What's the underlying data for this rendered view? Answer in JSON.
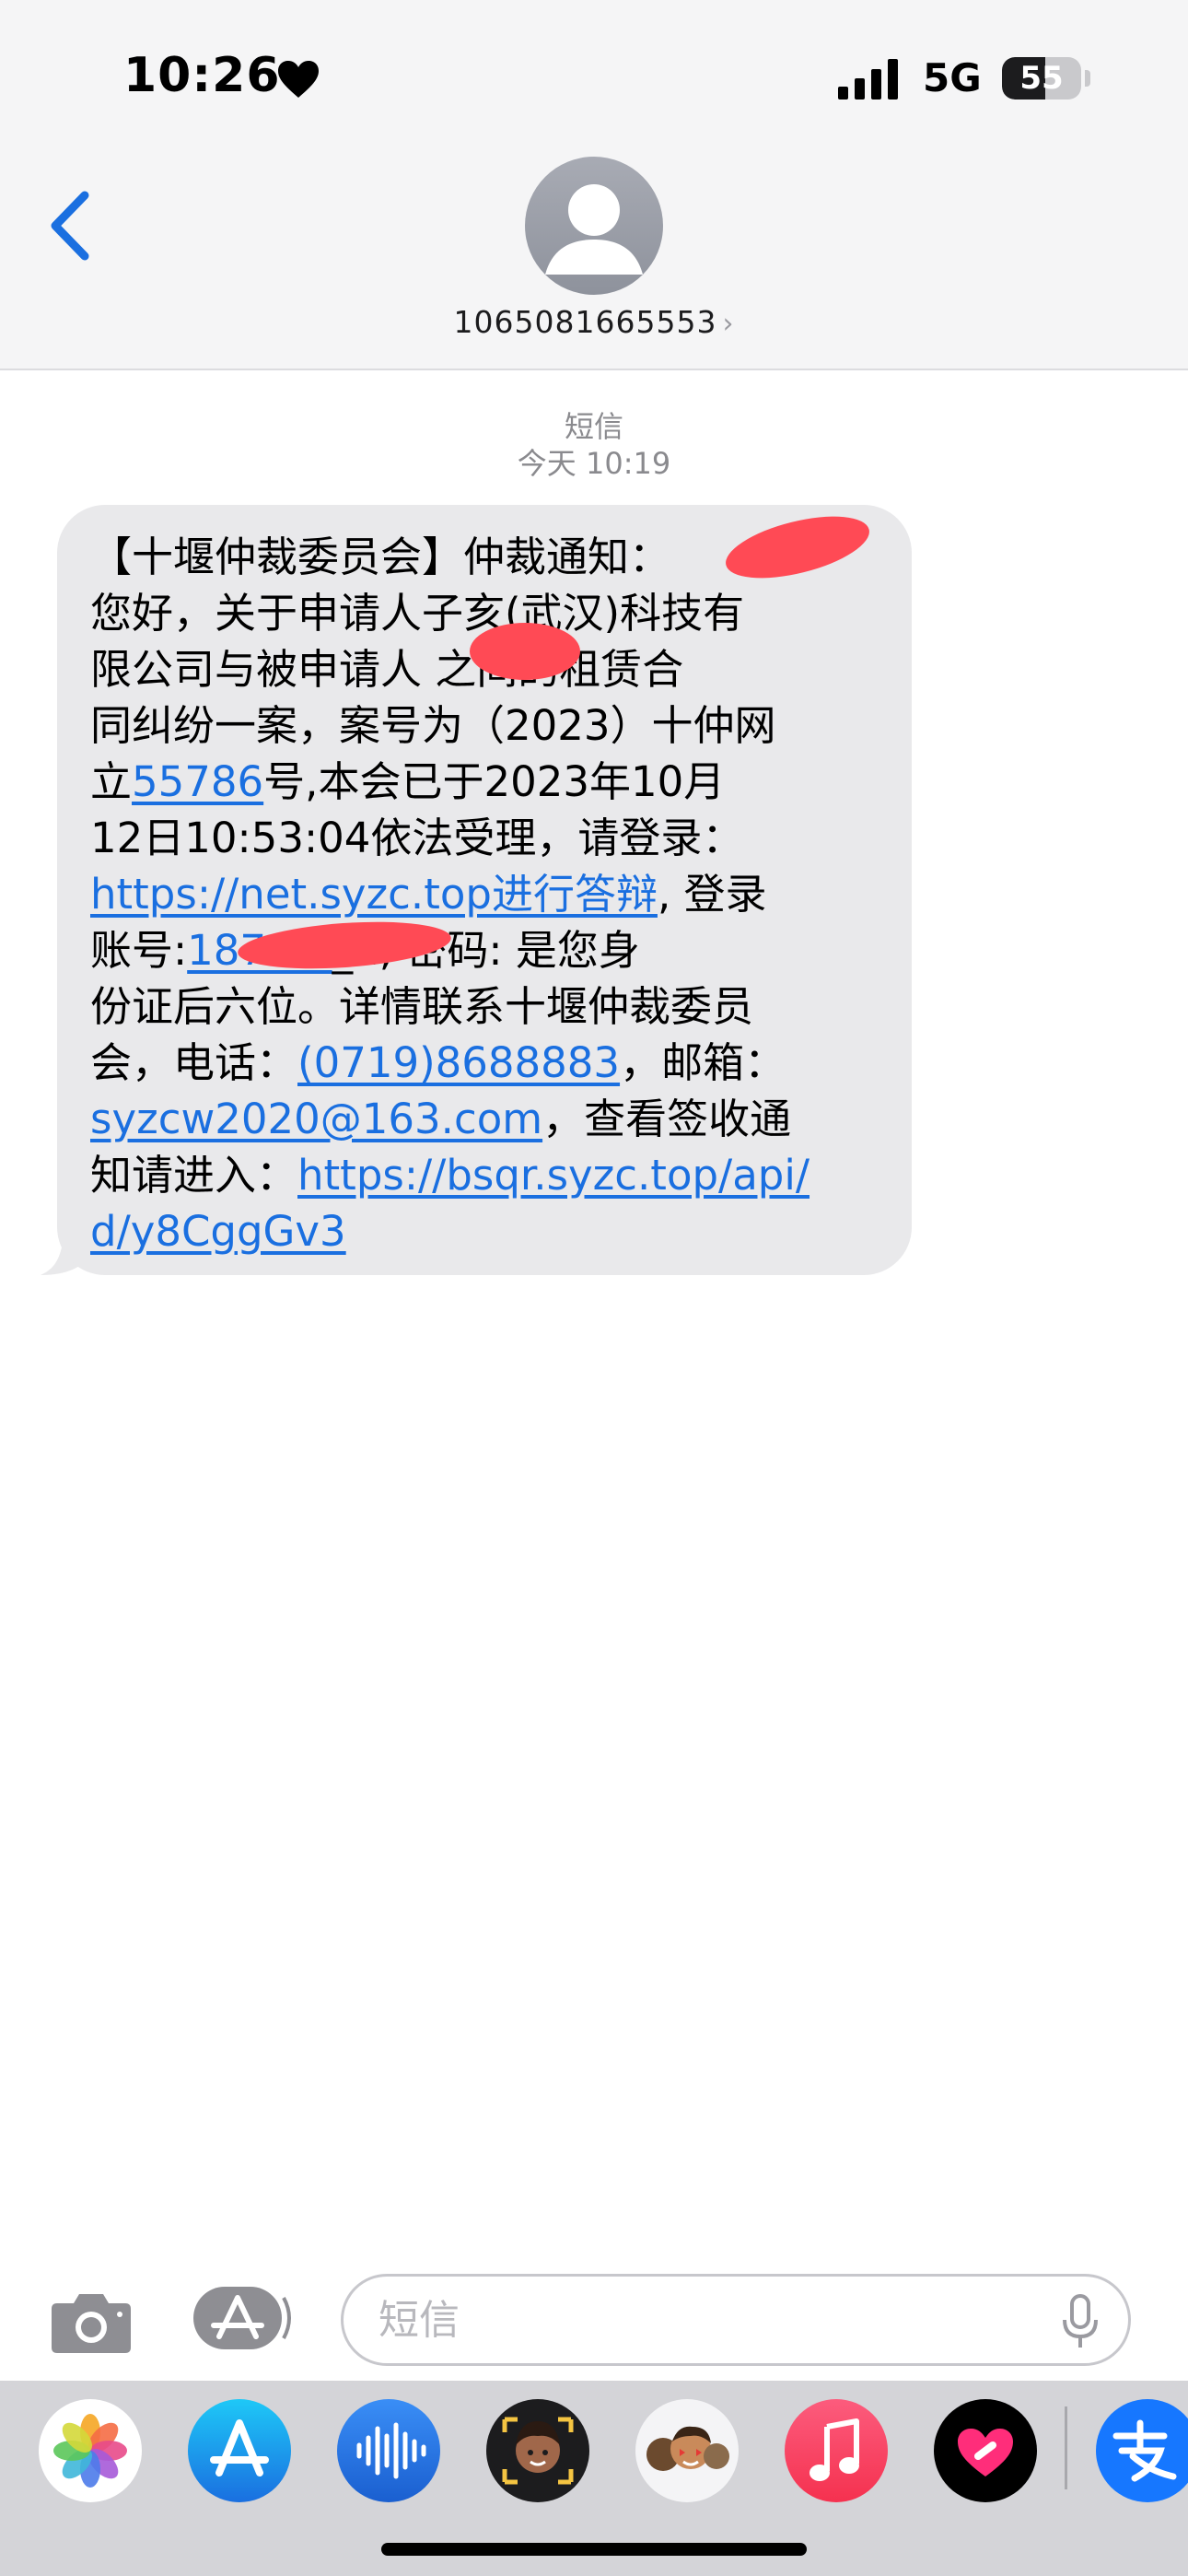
{
  "status_bar": {
    "time": "10:26",
    "network": "5G",
    "battery": "55"
  },
  "header": {
    "contact": "1065081665553",
    "chevron": "›"
  },
  "thread": {
    "type_label": "短信",
    "timestamp": "今天 10:19"
  },
  "message": {
    "lines": [
      [
        {
          "t": "【十堰仲裁委员会】仲裁通知："
        }
      ],
      [
        {
          "t": "您好，关于申请人子亥(武汉)科技有"
        }
      ],
      [
        {
          "t": "限公司与被申请人    之间的租赁合"
        }
      ],
      [
        {
          "t": "同纠纷一案，案号为（2023）十仲网"
        }
      ],
      [
        {
          "t": "立"
        },
        {
          "t": "55786",
          "link": true
        },
        {
          "t": "号,本会已于2023年10月"
        }
      ],
      [
        {
          "t": "12日10:53:04依法受理，请登录："
        }
      ],
      [
        {
          "t": "https://net.syzc.top进行答辩",
          "link": true
        },
        {
          "t": ", 登录"
        }
      ],
      [
        {
          "t": "账号:"
        },
        {
          "t": "187         91",
          "link": true
        },
        {
          "t": "_2, 密码: 是您身"
        }
      ],
      [
        {
          "t": "份证后六位。详情联系十堰仲裁委员"
        }
      ],
      [
        {
          "t": "会，电话："
        },
        {
          "t": "(0719)8688883",
          "link": true
        },
        {
          "t": "，邮箱："
        }
      ],
      [
        {
          "t": "syzcw2020@163.com",
          "link": true
        },
        {
          "t": "，查看签收通"
        }
      ],
      [
        {
          "t": "知请进入："
        },
        {
          "t": "https://bsqr.syzc.top/api/",
          "link": true
        }
      ],
      [
        {
          "t": "d/y8CggGv3",
          "link": true
        }
      ]
    ]
  },
  "input": {
    "placeholder": "短信"
  },
  "colors": {
    "accent": "#1a6fe0",
    "bubble": "#e9e9eb",
    "redaction": "#ff4a55"
  },
  "apps": [
    {
      "name": "photos-app-icon"
    },
    {
      "name": "app-store-app-icon"
    },
    {
      "name": "audio-message-app-icon"
    },
    {
      "name": "memoji-app-icon"
    },
    {
      "name": "memoji-stickers-app-icon"
    },
    {
      "name": "music-app-icon"
    },
    {
      "name": "digital-touch-app-icon"
    },
    {
      "name": "alipay-app-icon"
    }
  ]
}
